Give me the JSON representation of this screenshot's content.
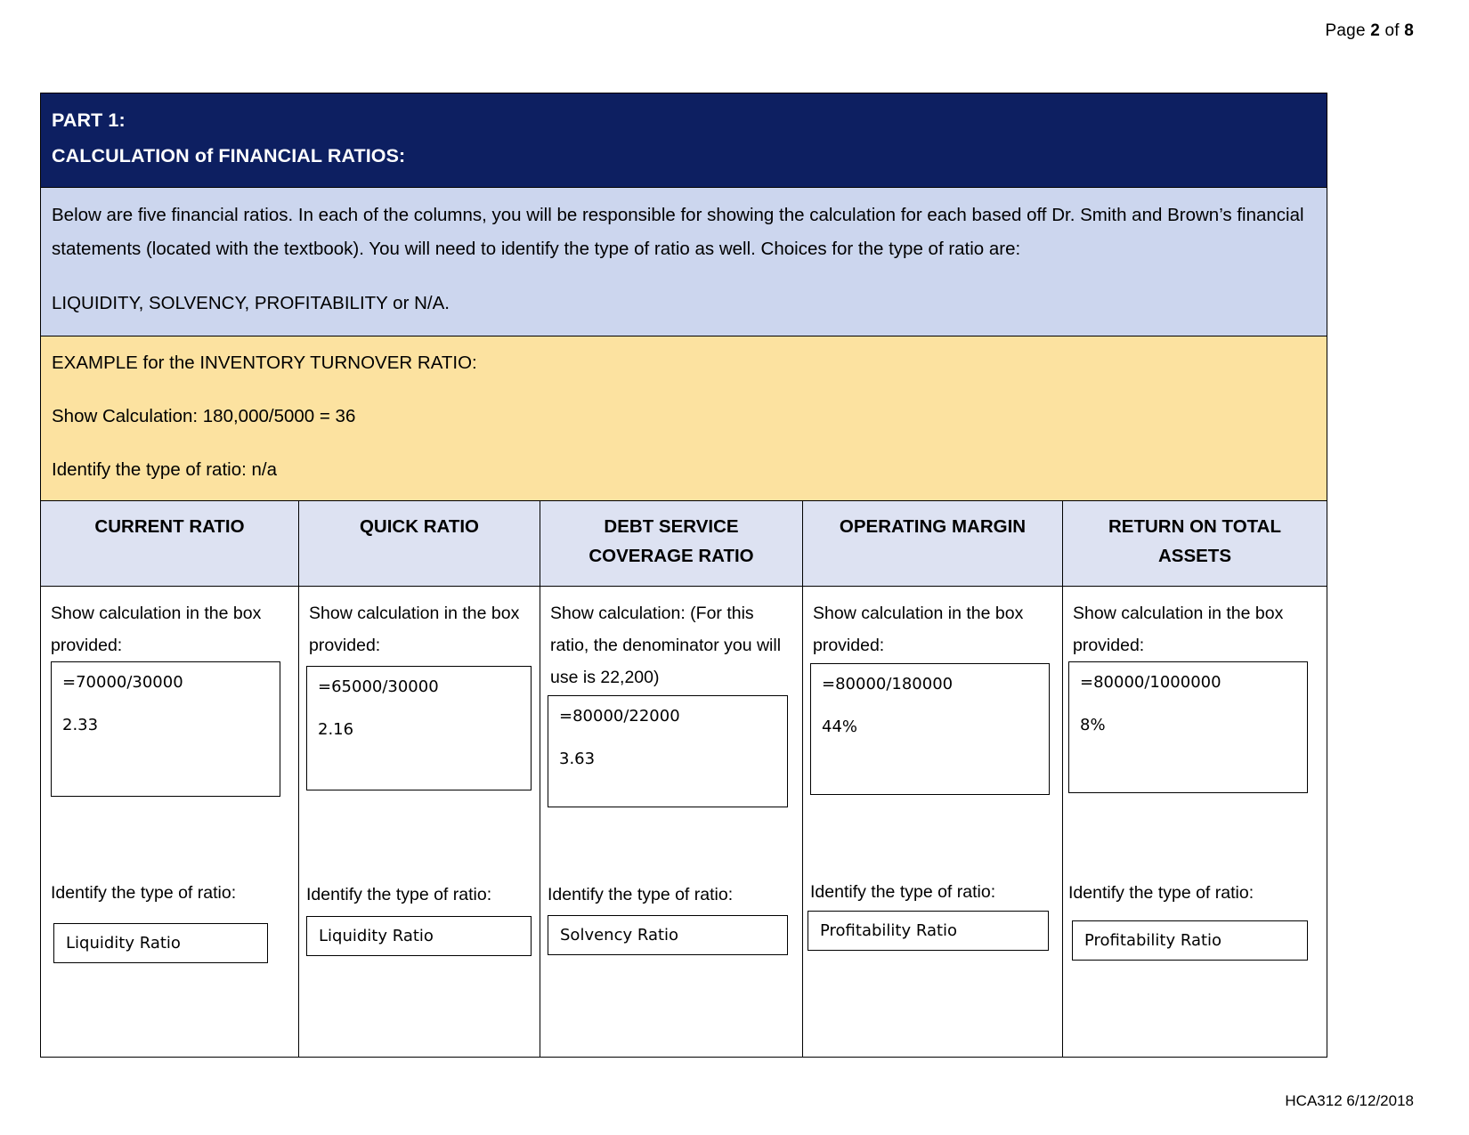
{
  "page": {
    "header_prefix": "Page",
    "header_number": "2",
    "header_middle": "of",
    "header_total": "8",
    "footer": "HCA312 6/12/2018"
  },
  "title_band": {
    "line1": "PART 1:",
    "line2": "CALCULATION of FINANCIAL RATIOS:",
    "background": "#0d1f61",
    "text_color": "#ffffff"
  },
  "instructions": {
    "background": "#ccd6ee",
    "paragraph1": "Below are five financial ratios. In each of the columns, you will be responsible for showing the calculation for each based off Dr. Smith and Brown’s financial statements (located with the textbook). You will need to identify the type of ratio as well. Choices for the type of ratio are:",
    "paragraph2": "LIQUIDITY, SOLVENCY, PROFITABILITY or N/A."
  },
  "example": {
    "background": "#fce2a0",
    "heading": "EXAMPLE for the INVENTORY TURNOVER RATIO:",
    "calculation": "Show Calculation: 180,000/5000 = 36",
    "type": "Identify the type of ratio:  n/a"
  },
  "table": {
    "header_background": "#dde2f2",
    "identify_label": "Identify the type of ratio:",
    "columns": [
      {
        "header": "CURRENT RATIO",
        "header_line2": "",
        "prompt": "Show calculation in the box provided:",
        "calc_formula": "=70000/30000",
        "calc_result": "2.33",
        "ratio_type": "Liquidity Ratio"
      },
      {
        "header": "QUICK RATIO",
        "header_line2": "",
        "prompt": "Show calculation in the box provided:",
        "calc_formula": "=65000/30000",
        "calc_result": "2.16",
        "ratio_type": "Liquidity Ratio"
      },
      {
        "header": "DEBT SERVICE",
        "header_line2": "COVERAGE RATIO",
        "prompt": "Show calculation: (For this ratio, the denominator you will use is 22,200)",
        "calc_formula": "=80000/22000",
        "calc_result": "3.63",
        "ratio_type": "Solvency Ratio"
      },
      {
        "header": "OPERATING MARGIN",
        "header_line2": "",
        "prompt": "Show calculation in the box provided:",
        "calc_formula": "=80000/180000",
        "calc_result": "44%",
        "ratio_type": "Profitability Ratio"
      },
      {
        "header": "RETURN ON TOTAL",
        "header_line2": "ASSETS",
        "prompt": "Show calculation in the box provided:",
        "calc_formula": "=80000/1000000",
        "calc_result": "8%",
        "ratio_type": "Profitability Ratio"
      }
    ]
  }
}
